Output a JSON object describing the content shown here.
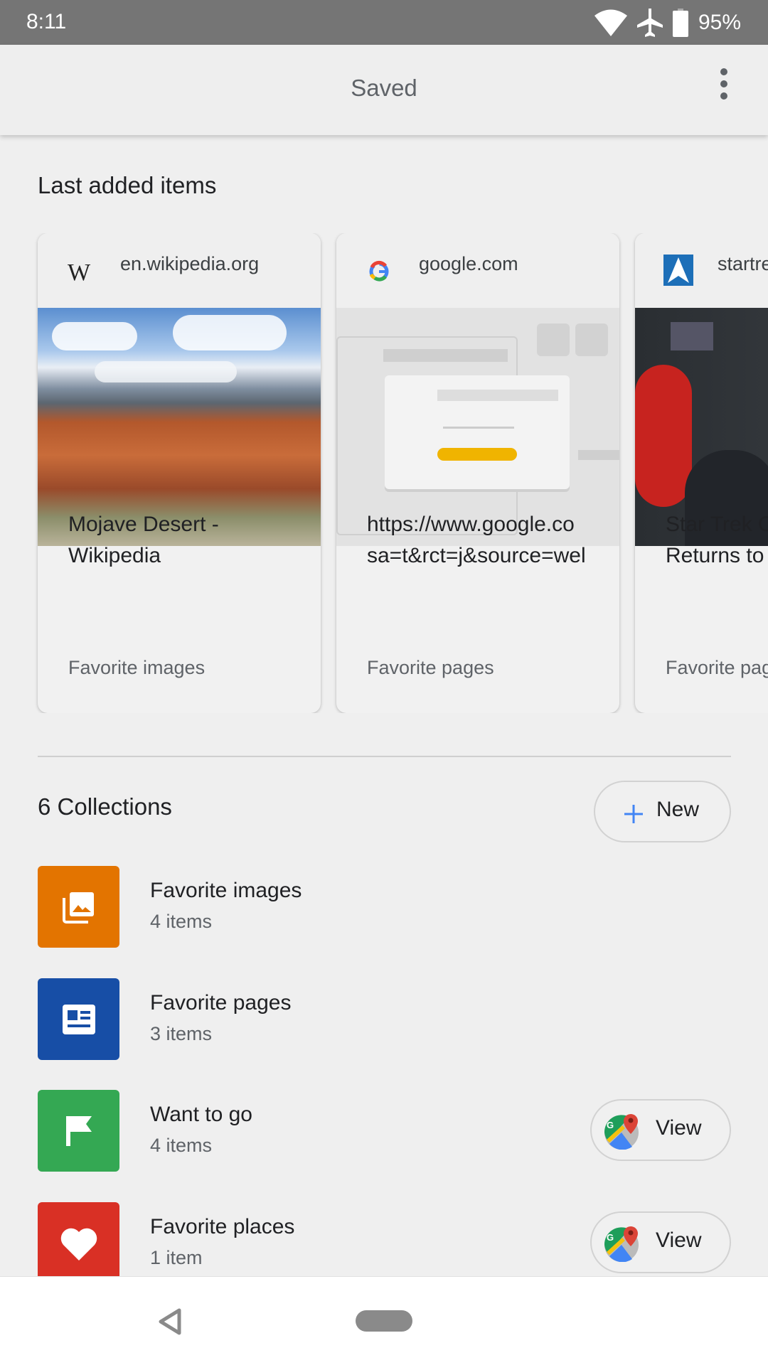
{
  "status_bar": {
    "time": "8:11",
    "battery": "95%",
    "icons": [
      "wifi-icon",
      "airplane-icon",
      "battery-icon"
    ]
  },
  "app_bar": {
    "title": "Saved",
    "menu_icon": "more-vert-icon"
  },
  "last_added": {
    "heading": "Last added items",
    "cards": [
      {
        "site": "en.wikipedia.org",
        "favicon": "wikipedia-icon",
        "title_line1": "Mojave Desert -",
        "title_line2": "Wikipedia",
        "collection": "Favorite images"
      },
      {
        "site": "google.com",
        "favicon": "google-icon",
        "title_line1": "https://www.google.co",
        "title_line2": "sa=t&rct=j&source=wel",
        "collection": "Favorite pages"
      },
      {
        "site": "startre",
        "favicon": "startrek-icon",
        "title_line1": "Star Trek O",
        "title_line2": "Returns to",
        "collection": "Favorite pag"
      }
    ]
  },
  "collections": {
    "heading": "6 Collections",
    "new_label": "New",
    "items": [
      {
        "name": "Favorite images",
        "count": "4 items",
        "color": "#e37400",
        "icon": "image-icon"
      },
      {
        "name": "Favorite pages",
        "count": "3 items",
        "color": "#174ea6",
        "icon": "article-icon"
      },
      {
        "name": "Want to go",
        "count": "4 items",
        "color": "#34a853",
        "icon": "flag-icon",
        "action": "View"
      },
      {
        "name": "Favorite places",
        "count": "1 item",
        "color": "#d93025",
        "icon": "heart-icon",
        "action": "View"
      }
    ]
  }
}
